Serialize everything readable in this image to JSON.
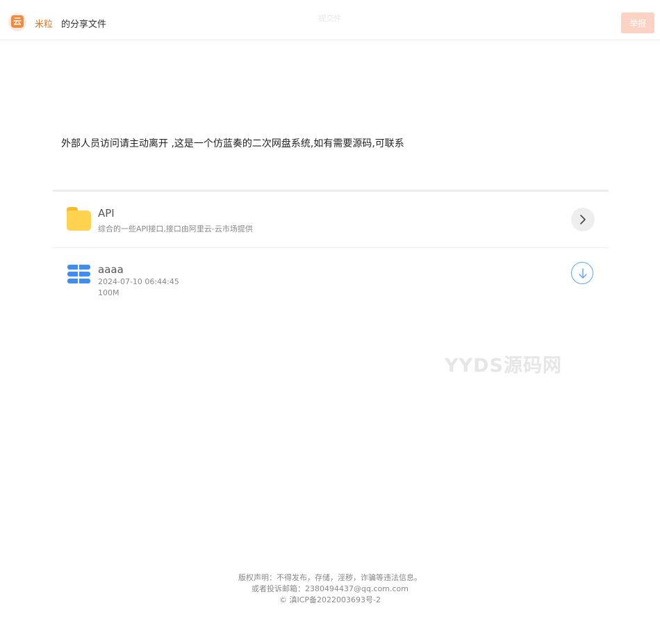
{
  "header": {
    "logo_glyph": "云",
    "username": "米粒",
    "share_title": "的分享文件",
    "center_text": "提交件",
    "report_label": "举报"
  },
  "notice": "外部人员访问请主动离开 ,这是一个仿蓝奏的二次网盘系统,如有需要源码,可联系",
  "items": [
    {
      "type": "folder",
      "name": "API",
      "description": "综合的一些API接口,接口由阿里云-云市场提供",
      "icon": "folder-icon",
      "action_icon": "chevron-right-icon"
    },
    {
      "type": "file",
      "name": "aaaa",
      "date": "2024-07-10 06:44:45",
      "size": "100M",
      "icon": "file-icon",
      "action_icon": "download-icon"
    }
  ],
  "watermark": "YYDS源码网",
  "footer": {
    "line1": "版权声明：不得发布，存储，淫秽，诈骗等违法信息。",
    "line2": "或者投诉邮箱：2380494437@qq.com.com",
    "line3": "© 滇ICP备2022003693号-2"
  },
  "colors": {
    "accent": "#e0752b",
    "report_button": "#fbd2c4",
    "folder": "#ffd24f",
    "file": "#3d8eef",
    "download_ring": "#5aa6ee"
  }
}
